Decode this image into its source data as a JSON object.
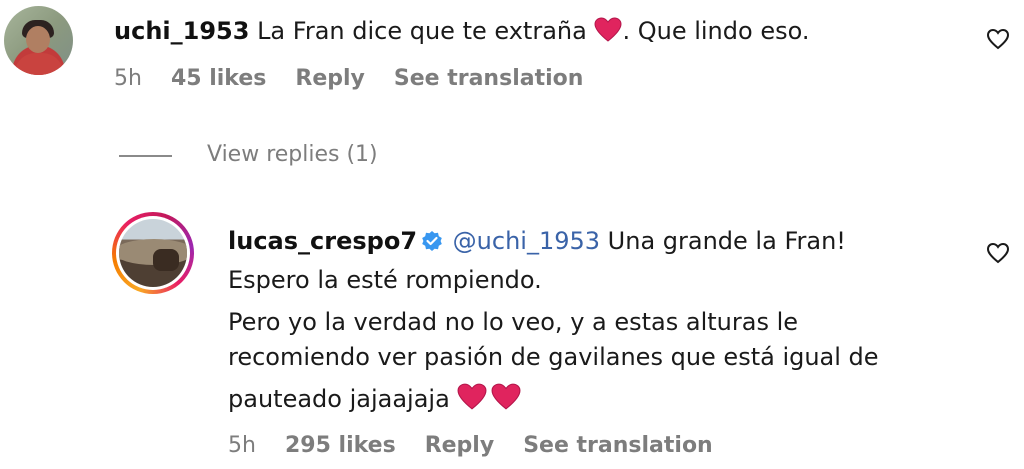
{
  "comment": {
    "username": "uchi_1953",
    "text": "La Fran dice que te extraña",
    "text_after_heart": ". Que lindo eso.",
    "time": "5h",
    "likes": "45 likes",
    "reply_label": "Reply",
    "translate_label": "See translation",
    "view_replies_label": "View replies (1)"
  },
  "reply": {
    "username": "lucas_crespo7",
    "mention": "@uchi_1953",
    "lines": [
      "Una grande la Fran!",
      "Espero la esté rompiendo.",
      "Pero yo la verdad no lo veo, y a estas alturas le",
      "recomiendo ver pasión de gavilanes que está igual de",
      "pauteado jajaajaja"
    ],
    "time": "5h",
    "likes": "295 likes",
    "reply_label": "Reply",
    "translate_label": "See translation"
  },
  "colors": {
    "heart": "#e0245e",
    "verified": "#3897f0",
    "mention": "#3a63a8",
    "meta_gray": "#7d7d7d"
  },
  "icons": [
    "heart-emoji-icon",
    "like-heart-icon",
    "verified-badge-icon"
  ]
}
